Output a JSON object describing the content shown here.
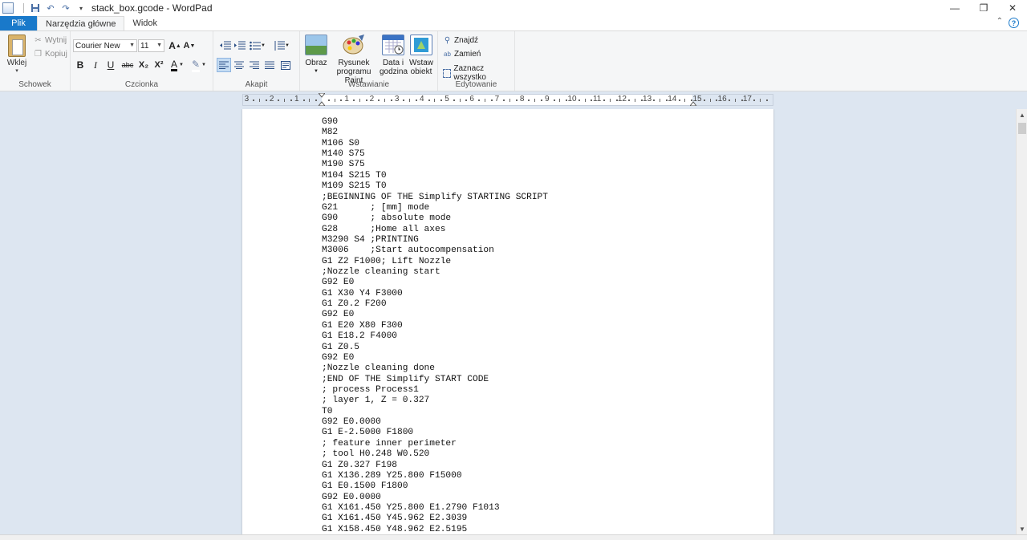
{
  "window": {
    "title": "stack_box.gcode - WordPad",
    "minimize": "—",
    "maximize": "❐",
    "close": "✕"
  },
  "tabs": {
    "file": "Plik",
    "home": "Narzędzia główne",
    "view": "Widok"
  },
  "ribbon": {
    "clipboard": {
      "label": "Schowek",
      "paste": "Wklej",
      "cut": "Wytnij",
      "copy": "Kopiuj"
    },
    "font": {
      "label": "Czcionka",
      "family": "Courier New",
      "size": "11",
      "bold": "B",
      "italic": "I",
      "underline": "U",
      "strikethrough": "abc",
      "subscript": "X₂",
      "superscript": "X²",
      "grow": "A",
      "shrink": "A",
      "color": "A"
    },
    "paragraph": {
      "label": "Akapit"
    },
    "insert": {
      "label": "Wstawianie",
      "picture": "Obraz",
      "paint": "Rysunek programu Paint",
      "datetime": "Data i godzina",
      "object": "Wstaw obiekt"
    },
    "editing": {
      "label": "Edytowanie",
      "find": "Znajdź",
      "replace": "Zamień",
      "select_all": "Zaznacz wszystko"
    }
  },
  "ruler": {
    "numbers": [
      "3",
      "2",
      "1",
      "1",
      "2",
      "3",
      "4",
      "5",
      "6",
      "7",
      "8",
      "9",
      "10",
      "11",
      "12",
      "13",
      "14",
      "15",
      "16",
      "17"
    ]
  },
  "document": {
    "lines": [
      "G90",
      "M82",
      "M106 S0",
      "M140 S75",
      "M190 S75",
      "M104 S215 T0",
      "M109 S215 T0",
      ";BEGINNING OF THE Simplify STARTING SCRIPT",
      "G21      ; [mm] mode",
      "G90      ; absolute mode",
      "G28      ;Home all axes",
      "M3290 S4 ;PRINTING",
      "M3006    ;Start autocompensation",
      "G1 Z2 F1000; Lift Nozzle",
      ";Nozzle cleaning start",
      "G92 E0",
      "G1 X30 Y4 F3000",
      "G1 Z0.2 F200",
      "G92 E0",
      "G1 E20 X80 F300",
      "G1 E18.2 F4000",
      "G1 Z0.5",
      "G92 E0",
      ";Nozzle cleaning done",
      ";END OF THE Simplify START CODE",
      "; process Process1",
      "; layer 1, Z = 0.327",
      "T0",
      "G92 E0.0000",
      "G1 E-2.5000 F1800",
      "; feature inner perimeter",
      "; tool H0.248 W0.520",
      "G1 Z0.327 F198",
      "G1 X136.289 Y25.800 F15000",
      "G1 E0.1500 F1800",
      "G92 E0.0000",
      "G1 X161.450 Y25.800 E1.2790 F1013",
      "G1 X161.450 Y45.962 E2.3039",
      "G1 X158.450 Y48.962 E2.5195"
    ]
  }
}
